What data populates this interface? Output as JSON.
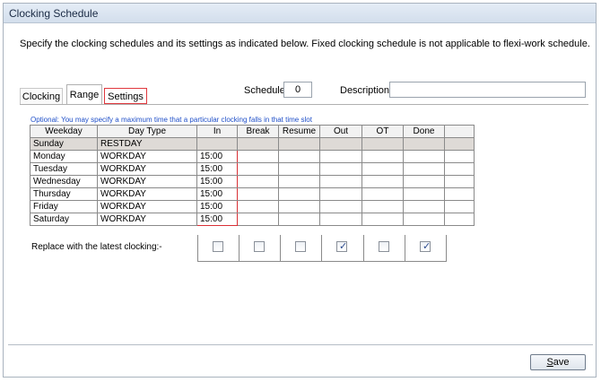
{
  "window": {
    "title": "Clocking Schedule"
  },
  "instructions": "Specify the clocking schedules and its settings as indicated below. Fixed clocking schedule is not applicable to flexi-work schedule.",
  "tabs": [
    {
      "label": "Clocking"
    },
    {
      "label": "Range"
    },
    {
      "label": "Settings"
    }
  ],
  "schedule": {
    "label": "Schedule",
    "value": "0"
  },
  "description": {
    "label": "Description",
    "value": ""
  },
  "optional_note": "Optional: You may specify a maximum time that a particular clocking falls in that time slot",
  "table": {
    "columns": [
      "Weekday",
      "Day Type",
      "In",
      "Break",
      "Resume",
      "Out",
      "OT",
      "Done"
    ],
    "rows": [
      {
        "weekday": "Sunday",
        "day_type": "RESTDAY",
        "in": ""
      },
      {
        "weekday": "Monday",
        "day_type": "WORKDAY",
        "in": "15:00"
      },
      {
        "weekday": "Tuesday",
        "day_type": "WORKDAY",
        "in": "15:00"
      },
      {
        "weekday": "Wednesday",
        "day_type": "WORKDAY",
        "in": "15:00"
      },
      {
        "weekday": "Thursday",
        "day_type": "WORKDAY",
        "in": "15:00"
      },
      {
        "weekday": "Friday",
        "day_type": "WORKDAY",
        "in": "15:00"
      },
      {
        "weekday": "Saturday",
        "day_type": "WORKDAY",
        "in": "15:00"
      }
    ]
  },
  "replace": {
    "label": "Replace with the latest clocking:-",
    "checkboxes": [
      {
        "column": "In",
        "checked": false
      },
      {
        "column": "Break",
        "checked": false
      },
      {
        "column": "Resume",
        "checked": false
      },
      {
        "column": "Out",
        "checked": true
      },
      {
        "column": "OT",
        "checked": false
      },
      {
        "column": "Done",
        "checked": true
      }
    ]
  },
  "save_button": {
    "label": "Save",
    "mnemonic": "S",
    "rest": "ave"
  },
  "colors": {
    "highlight_border": "#d93036",
    "optional_text": "#1f4fc8",
    "restday_row": "#dedad6"
  }
}
